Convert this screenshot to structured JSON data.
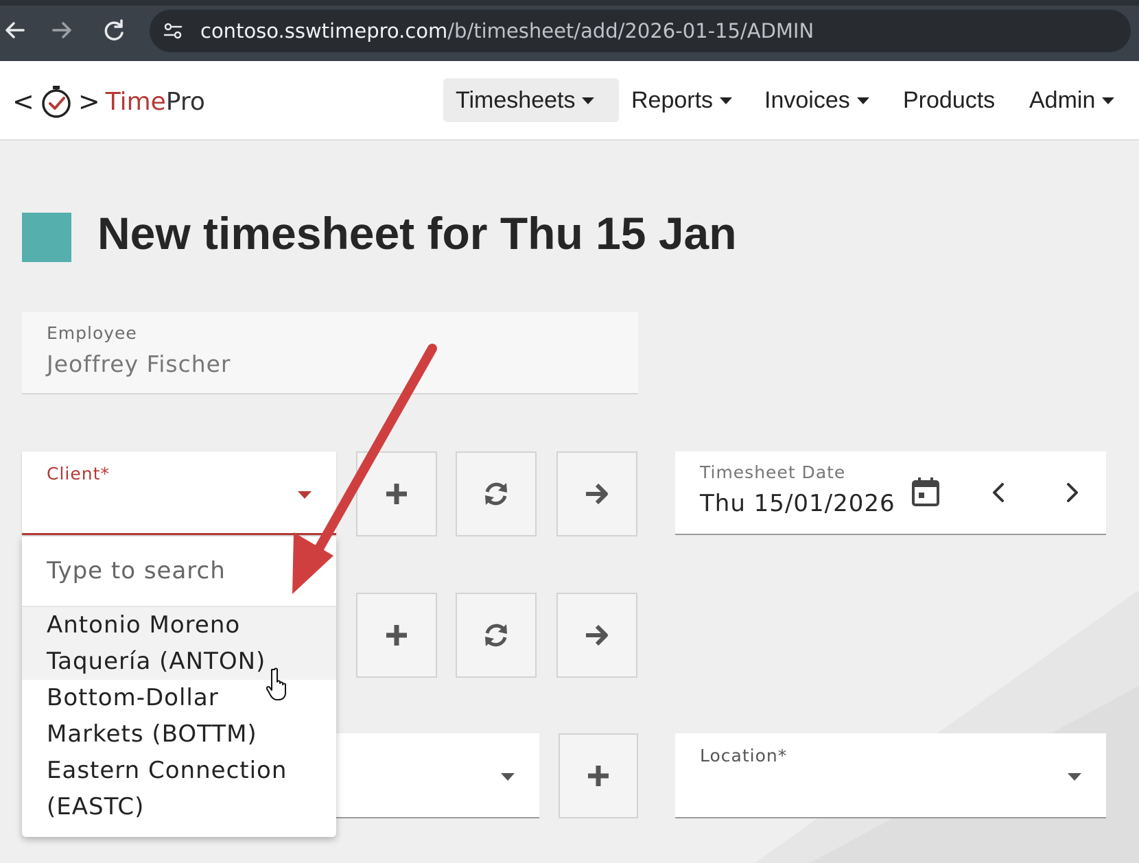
{
  "browser": {
    "url_host": "contoso.sswtimepro.com",
    "url_path": "/b/timesheet/add/2026-01-15/ADMIN"
  },
  "brand": {
    "bracket_left": "<",
    "bracket_right": ">",
    "name_accent": "Time",
    "name_rest": "Pro"
  },
  "nav": {
    "items": [
      {
        "label": "Timesheets",
        "has_menu": true
      },
      {
        "label": "Reports",
        "has_menu": true
      },
      {
        "label": "Invoices",
        "has_menu": true
      },
      {
        "label": "Products",
        "has_menu": false
      },
      {
        "label": "Admin",
        "has_menu": true
      }
    ]
  },
  "page": {
    "title": "New timesheet for Thu 15 Jan",
    "accent_color": "#55b0ad"
  },
  "form": {
    "employee": {
      "label": "Employee",
      "value": "Jeoffrey Fischer"
    },
    "client": {
      "label": "Client*",
      "value": ""
    },
    "timesheet_date": {
      "label": "Timesheet Date",
      "value": "Thu 15/01/2026"
    },
    "location": {
      "label": "Location*",
      "value": ""
    }
  },
  "client_dropdown": {
    "search_placeholder": "Type to search",
    "options": [
      {
        "line1": "Antonio Moreno",
        "line2": "Taquería (ANTON)"
      },
      {
        "line1": "Bottom-Dollar",
        "line2": "Markets (BOTTM)"
      },
      {
        "line1": "Eastern Connection",
        "line2": "(EASTC)"
      }
    ]
  },
  "colors": {
    "brand_red": "#b53a36",
    "annotation_arrow": "#d03f3f"
  }
}
